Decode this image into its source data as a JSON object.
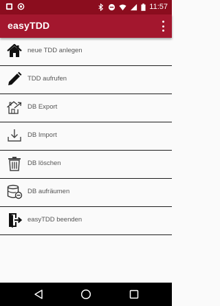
{
  "status_bar": {
    "time": "11:57",
    "icons": [
      "app-notification-icon",
      "sync-notification-icon",
      "bluetooth-icon",
      "do-not-disturb-icon",
      "wifi-icon",
      "signal-icon",
      "battery-icon"
    ]
  },
  "app_bar": {
    "title": "easyTDD",
    "menu_icon": "overflow-menu-icon"
  },
  "menu": {
    "items": [
      {
        "label": "neue TDD anlegen",
        "icon": "home-icon"
      },
      {
        "label": "TDD aufrufen",
        "icon": "pencil-icon"
      },
      {
        "label": "DB Export",
        "icon": "export-house-icon"
      },
      {
        "label": "DB Import",
        "icon": "download-icon"
      },
      {
        "label": "DB löschen",
        "icon": "trash-icon"
      },
      {
        "label": "DB aufräumen",
        "icon": "database-clean-icon"
      },
      {
        "label": "easyTDD beenden",
        "icon": "exit-icon"
      }
    ]
  },
  "nav_bar": {
    "buttons": [
      "back-icon",
      "home-circle-icon",
      "recents-icon"
    ]
  },
  "colors": {
    "status_bar": "#8b0d1e",
    "app_bar": "#a3172e",
    "divider": "#1a1a1a",
    "background": "#fafafa"
  }
}
